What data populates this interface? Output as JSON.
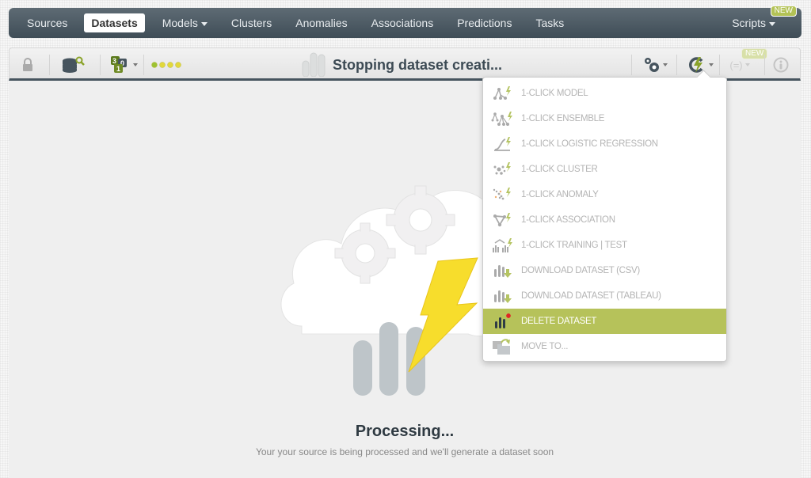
{
  "nav": {
    "items": [
      {
        "label": "Sources",
        "active": false
      },
      {
        "label": "Datasets",
        "active": true
      },
      {
        "label": "Models",
        "active": false,
        "dropdown": true
      },
      {
        "label": "Clusters",
        "active": false
      },
      {
        "label": "Anomalies",
        "active": false
      },
      {
        "label": "Associations",
        "active": false
      },
      {
        "label": "Predictions",
        "active": false
      },
      {
        "label": "Tasks",
        "active": false
      }
    ],
    "scripts_label": "Scripts",
    "scripts_badge": "NEW"
  },
  "toolbar": {
    "title": "Stopping dataset creati...",
    "icons": [
      "lock-icon",
      "dataset-search-icon",
      "field-types-icon",
      "status-dots-icon",
      "configure-icon",
      "one-click-actions-icon",
      "whizzml-icon",
      "info-icon"
    ],
    "whizzml_badge": "NEW",
    "status_dot_colors": [
      "#9dc231",
      "#e2d83a",
      "#e2d83a",
      "#e2d83a"
    ]
  },
  "dropdown": {
    "items": [
      {
        "label": "1-CLICK MODEL",
        "icon": "model-icon",
        "highlight": false
      },
      {
        "label": "1-CLICK ENSEMBLE",
        "icon": "ensemble-icon",
        "highlight": false
      },
      {
        "label": "1-CLICK LOGISTIC REGRESSION",
        "icon": "logistic-regression-icon",
        "highlight": false
      },
      {
        "label": "1-CLICK CLUSTER",
        "icon": "cluster-icon",
        "highlight": false
      },
      {
        "label": "1-CLICK ANOMALY",
        "icon": "anomaly-icon",
        "highlight": false
      },
      {
        "label": "1-CLICK ASSOCIATION",
        "icon": "association-icon",
        "highlight": false
      },
      {
        "label": "1-CLICK TRAINING | TEST",
        "icon": "training-test-icon",
        "highlight": false
      },
      {
        "label": "DOWNLOAD DATASET (CSV)",
        "icon": "download-icon",
        "highlight": false
      },
      {
        "label": "DOWNLOAD DATASET (TABLEAU)",
        "icon": "download-icon",
        "highlight": false
      },
      {
        "label": "DELETE DATASET",
        "icon": "delete-dataset-icon",
        "highlight": true
      },
      {
        "label": "MOVE TO...",
        "icon": "move-folder-icon",
        "highlight": false
      }
    ]
  },
  "main": {
    "title": "Processing...",
    "subtitle": "Your your source is being processed and we'll generate a dataset soon"
  },
  "colors": {
    "accent": "#b6c25a",
    "nav_bg": "#4a5861",
    "lightning": "#f5dc2a"
  }
}
